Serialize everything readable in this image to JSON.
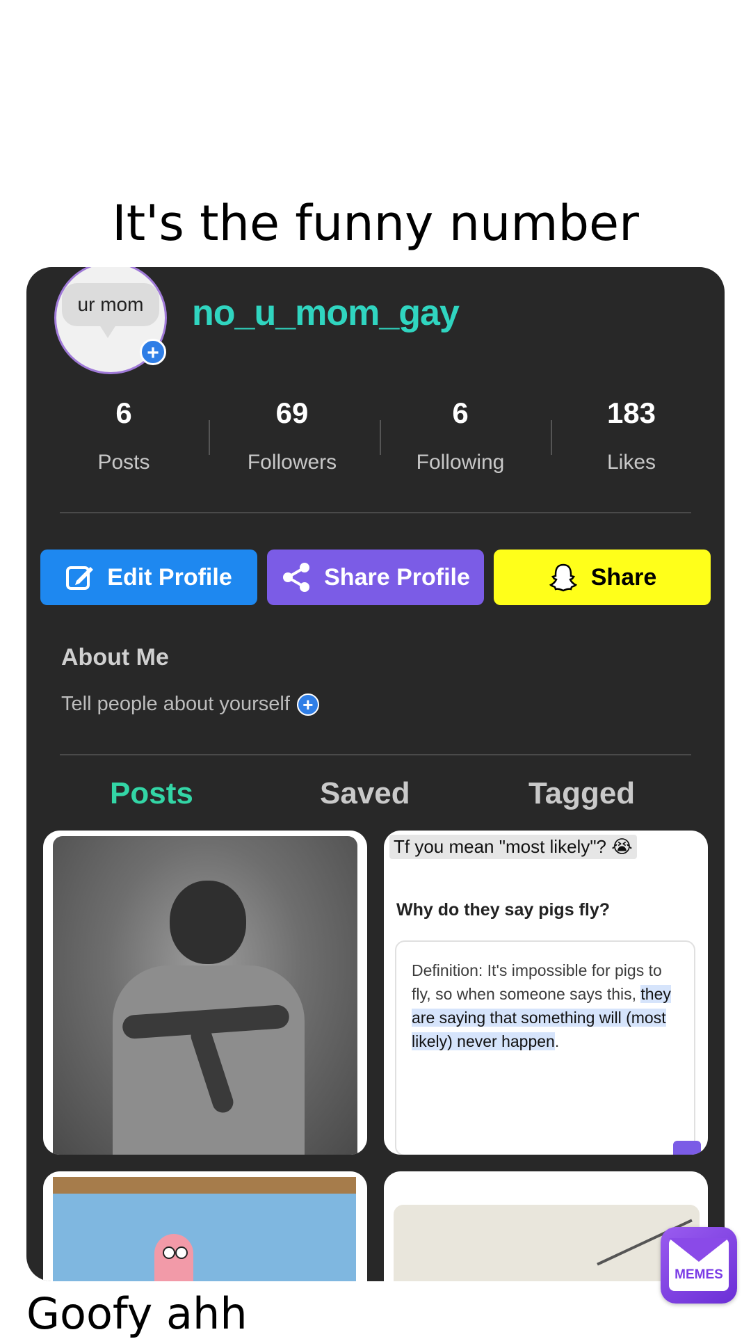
{
  "caption": {
    "top": "It's the funny number",
    "bottom": "Goofy ahh"
  },
  "profile": {
    "avatar_text": "ur mom",
    "username": "no_u_mom_gay",
    "stats": [
      {
        "value": "6",
        "label": "Posts"
      },
      {
        "value": "69",
        "label": "Followers"
      },
      {
        "value": "6",
        "label": "Following"
      },
      {
        "value": "183",
        "label": "Likes"
      }
    ]
  },
  "buttons": {
    "edit_profile": "Edit Profile",
    "share_profile": "Share Profile",
    "share": "Share"
  },
  "about": {
    "title": "About Me",
    "placeholder": "Tell people about yourself"
  },
  "tabs": {
    "posts": "Posts",
    "saved": "Saved",
    "tagged": "Tagged"
  },
  "post2": {
    "highlight": "Tf you mean \"most likely\"? 😭",
    "question": "Why do they say pigs fly?",
    "definition_start": "Definition: It's impossible for pigs to fly, so when someone says this,",
    "definition_highlight": "they are saying that something will (most likely) never happen",
    "definition_end": "."
  },
  "watermark": {
    "label": "MEMES"
  },
  "colors": {
    "username": "#30d5c0",
    "edit_button": "#1e88f0",
    "share_profile_button": "#7b5ce6",
    "share_button": "#ffff1a",
    "active_tab": "#33d6a6",
    "panel_bg": "#282828"
  }
}
